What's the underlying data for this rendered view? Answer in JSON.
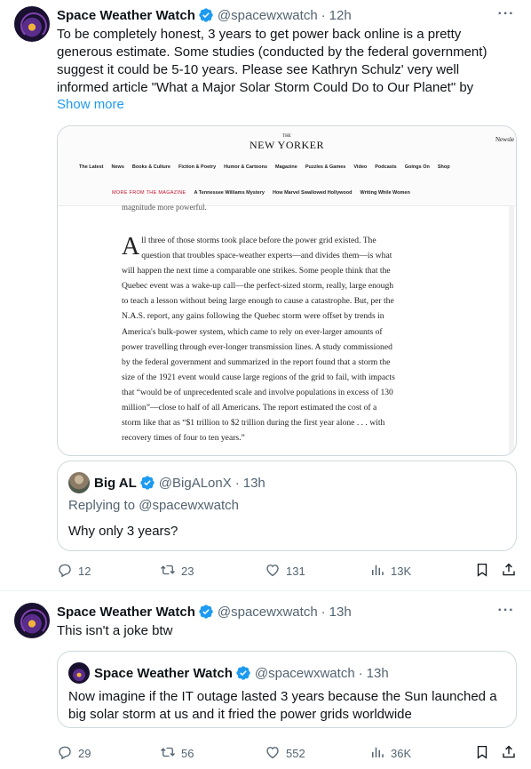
{
  "tweet1": {
    "author_name": "Space Weather Watch",
    "handle": "@spacewxwatch",
    "separator": "·",
    "time": "12h",
    "more_label": "···",
    "text_lines": [
      "To be completely honest, 3 years to get power back online is a pretty",
      "generous estimate. Some studies (conducted by the federal government)",
      "suggest it could be 5-10 years. Please see Kathryn Schulz' very well",
      "informed article \"What a Major Solar Storm Could Do to Our Planet\" by"
    ],
    "show_more": "Show more",
    "media": {
      "logo_small": "THE",
      "logo": "NEW YORKER",
      "corner_text": "Newsle",
      "nav": [
        "The Latest",
        "News",
        "Books & Culture",
        "Fiction & Poetry",
        "Humor & Cartoons",
        "Magazine",
        "Puzzles & Games",
        "Video",
        "Podcasts",
        "Goings On",
        "Shop"
      ],
      "sub_label": "MORE FROM THE MAGAZINE",
      "sub_links": [
        "A Tennessee Williams Mystery",
        "How Marvel Swallowed Hollywood",
        "Writing While Women"
      ],
      "cut_line": "magnitude more powerful.",
      "dropcap": "A",
      "article_lines": [
        "ll three of those storms took place before the power grid existed. The",
        "question that troubles space-weather experts—and divides them—is what",
        "will happen the next time a comparable one strikes. Some people think that the",
        "Quebec event was a wake-up call—the perfect-sized storm, really, large enough",
        "to teach a lesson without being large enough to cause a catastrophe. But, per the",
        "N.A.S. report, any gains following the Quebec storm were offset by trends in",
        "America's bulk-power system, which came to rely on ever-larger amounts of",
        "power travelling through ever-longer transmission lines. A study commissioned",
        "by the federal government and summarized in the report found that a storm the",
        "size of the 1921 event would cause large regions of the grid to fail, with impacts",
        "that “would be of unprecedented scale and involve populations in excess of 130",
        "million”—close to half of all Americans. The report estimated the cost of a",
        "storm like that as “$1 trillion to $2 trillion during the first year alone . . . with",
        "recovery times of four to ten years.”"
      ]
    },
    "quote": {
      "author_name": "Big AL",
      "handle": "@BigALonX",
      "separator": "·",
      "time": "13h",
      "replying_to": "Replying to @spacewxwatch",
      "text": "Why only 3 years?"
    },
    "actions": {
      "replies": "12",
      "reposts": "23",
      "likes": "131",
      "views": "13K"
    }
  },
  "tweet2": {
    "author_name": "Space Weather Watch",
    "handle": "@spacewxwatch",
    "separator": "·",
    "time": "13h",
    "more_label": "···",
    "text": "This isn't a joke btw",
    "quote": {
      "author_name": "Space Weather Watch",
      "handle": "@spacewxwatch",
      "separator": "·",
      "time": "13h",
      "text_lines": [
        "Now imagine if the IT outage lasted 3 years because the Sun launched a",
        "big solar storm at us and it fried the power grids worldwide"
      ]
    },
    "actions": {
      "replies": "29",
      "reposts": "56",
      "likes": "552",
      "views": "36K"
    }
  },
  "colors": {
    "text": "#0f1419",
    "secondary": "#536471",
    "link": "#1d9bf0",
    "verified": "#1d9bf0",
    "border": "#cfd9de"
  }
}
